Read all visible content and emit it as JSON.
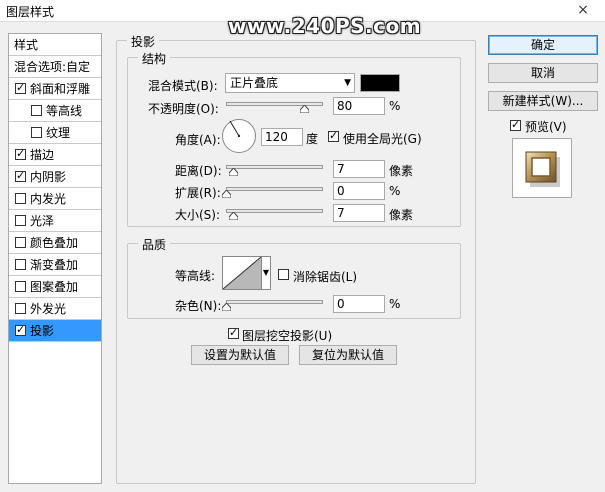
{
  "window": {
    "title": "图层样式",
    "close_glyph": "×"
  },
  "watermark": "www.240PS.com",
  "style_list": {
    "header": "样式",
    "blend_options": "混合选项:自定",
    "items": [
      {
        "label": "斜面和浮雕",
        "checked": true,
        "sub": false
      },
      {
        "label": "等高线",
        "checked": false,
        "sub": true
      },
      {
        "label": "纹理",
        "checked": false,
        "sub": true
      },
      {
        "label": "描边",
        "checked": true,
        "sub": false
      },
      {
        "label": "内阴影",
        "checked": true,
        "sub": false
      },
      {
        "label": "内发光",
        "checked": false,
        "sub": false
      },
      {
        "label": "光泽",
        "checked": false,
        "sub": false
      },
      {
        "label": "颜色叠加",
        "checked": false,
        "sub": false
      },
      {
        "label": "渐变叠加",
        "checked": false,
        "sub": false
      },
      {
        "label": "图案叠加",
        "checked": false,
        "sub": false
      },
      {
        "label": "外发光",
        "checked": false,
        "sub": false
      },
      {
        "label": "投影",
        "checked": true,
        "sub": false,
        "selected": true
      }
    ]
  },
  "panel": {
    "title": "投影",
    "structure": {
      "title": "结构",
      "blend_mode_label": "混合模式(B):",
      "blend_mode_value": "正片叠底",
      "blend_color": "#000000",
      "opacity_label": "不透明度(O):",
      "opacity_value": "80",
      "opacity_unit": "%",
      "angle_label": "角度(A):",
      "angle_value": "120",
      "angle_unit": "度",
      "global_light_label": "使用全局光(G)",
      "global_light_checked": true,
      "distance_label": "距离(D):",
      "distance_value": "7",
      "distance_unit": "像素",
      "spread_label": "扩展(R):",
      "spread_value": "0",
      "spread_unit": "%",
      "size_label": "大小(S):",
      "size_value": "7",
      "size_unit": "像素"
    },
    "quality": {
      "title": "品质",
      "contour_label": "等高线:",
      "antialias_label": "消除锯齿(L)",
      "antialias_checked": false,
      "noise_label": "杂色(N):",
      "noise_value": "0",
      "noise_unit": "%"
    },
    "knockout_label": "图层挖空投影(U)",
    "knockout_checked": true,
    "make_default": "设置为默认值",
    "reset_default": "复位为默认值"
  },
  "buttons": {
    "ok": "确定",
    "cancel": "取消",
    "new_style": "新建样式(W)...",
    "preview_label": "预览(V)",
    "preview_checked": true
  }
}
